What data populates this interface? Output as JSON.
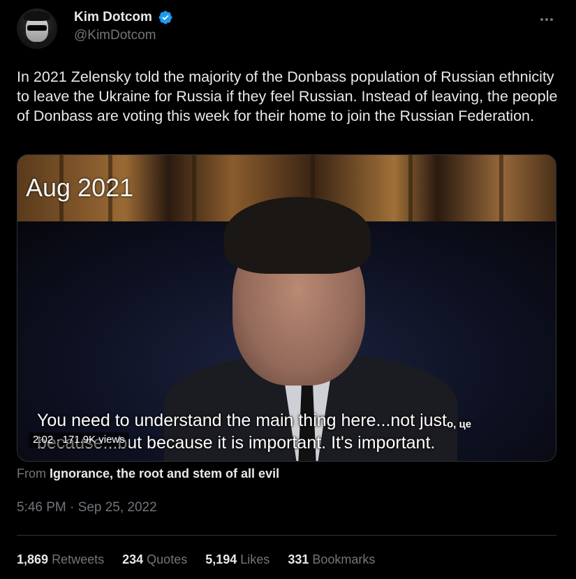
{
  "author": {
    "display_name": "Kim Dotcom",
    "handle": "@KimDotcom",
    "verified": true
  },
  "tweet": {
    "text": "In 2021 Zelensky told the majority of the Donbass population of Russian ethnicity to leave the Ukraine for Russia if they feel Russian. Instead of leaving, the people of Donbass are voting this week for their home to join the Russian Federation."
  },
  "media": {
    "date_overlay": "Aug 2021",
    "subtitle_line1": "You need to understand the main thing here...not just",
    "subtitle_line1_tail": "о, це",
    "subtitle_line2": "because...but because it is important. It's important.",
    "video_meta": "2:02 · 171.9K views"
  },
  "source": {
    "prefix": "From",
    "name": "Ignorance, the root and stem of all evil"
  },
  "timestamp": "5:46 PM · Sep 25, 2022",
  "stats": {
    "retweets": {
      "count": "1,869",
      "label": "Retweets"
    },
    "quotes": {
      "count": "234",
      "label": "Quotes"
    },
    "likes": {
      "count": "5,194",
      "label": "Likes"
    },
    "bookmarks": {
      "count": "331",
      "label": "Bookmarks"
    }
  },
  "colors": {
    "background": "#000000",
    "text": "#e7e9ea",
    "secondary": "#71767b",
    "verified_blue": "#1d9bf0",
    "divider": "#2f3336"
  },
  "icons": {
    "verified": "verified-badge-icon",
    "more": "more-options-icon"
  }
}
